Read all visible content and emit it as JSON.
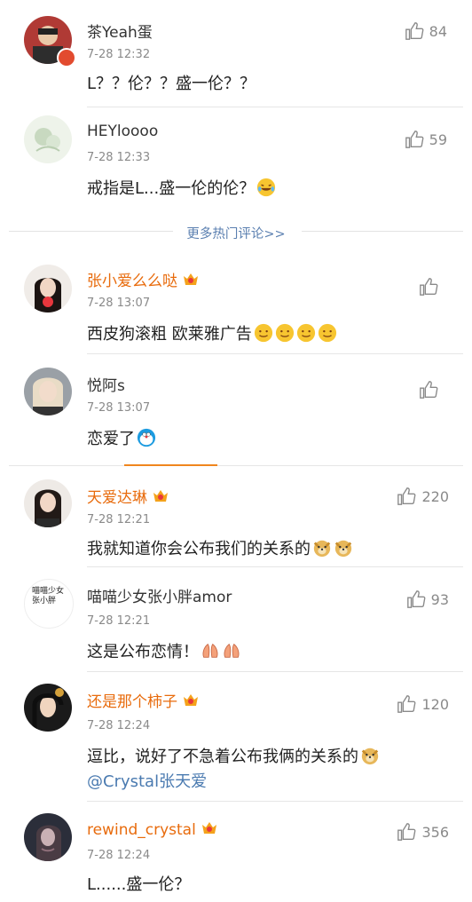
{
  "hot_comments": [
    {
      "name": "茶Yeah蛋",
      "time": "7-28 12:32",
      "text": "L？？伦？？盛一伦？？",
      "likes": "84"
    },
    {
      "name": "HEYloooo",
      "time": "7-28 12:33",
      "text": "戒指是L...盛一伦的伦？",
      "likes": "59"
    }
  ],
  "more_link": "更多热门评论>>",
  "new_comments": [
    {
      "name": "张小爱么么哒",
      "time": "7-28 13:07",
      "text": "西皮狗滚粗 欧莱雅广告",
      "likes": ""
    },
    {
      "name": "悦阿s",
      "time": "7-28 13:07",
      "text": "恋爱了",
      "likes": ""
    }
  ],
  "other_comments": [
    {
      "name": "天爱达琳",
      "time": "7-28 12:21",
      "text": "我就知道你会公布我们的关系的",
      "likes": "220"
    },
    {
      "name": "喵喵少女张小胖amor",
      "time": "7-28 12:21",
      "text": "这是公布恋情！",
      "likes": "93",
      "avatar_text": "喵喵少女张小胖"
    },
    {
      "name": "还是那个柿子",
      "time": "7-28 12:24",
      "text": "逗比，说好了不急着公布我俩的关系的",
      "mention": "@Crystal张天爱",
      "likes": "120"
    },
    {
      "name": "rewind_crystal",
      "time": "7-28 12:24",
      "text": "L......盛一伦？",
      "likes": "356"
    }
  ],
  "colors": {
    "name_orange": "#e86b0c",
    "link_blue": "#4a7ab0",
    "tab_orange": "#f0861e"
  }
}
